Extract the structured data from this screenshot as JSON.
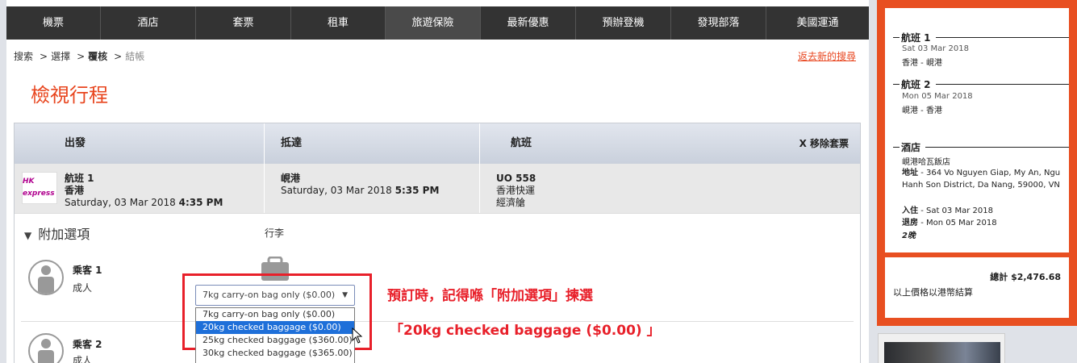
{
  "nav": [
    "機票",
    "酒店",
    "套票",
    "租車",
    "旅遊保險",
    "最新優惠",
    "預辦登機",
    "發現部落",
    "美國運通"
  ],
  "breadcrumb": {
    "step1": "搜索",
    "step2": "選擇",
    "step3": "覆核",
    "step4": "結帳"
  },
  "back_link": "返去新的搜尋",
  "page_title": "檢視行程",
  "table": {
    "headers": {
      "depart": "出發",
      "arrive": "抵達",
      "flight": "航班"
    },
    "remove": "X 移除套票",
    "row": {
      "airline_logo": "HK express",
      "flight_label": "航班 1",
      "origin": "香港",
      "depart_date": "Saturday, 03 Mar 2018",
      "depart_time": "4:35 PM",
      "dest": "峴港",
      "arrive_date": "Saturday, 03 Mar 2018",
      "arrive_time": "5:35 PM",
      "flight_no": "UO 558",
      "carrier": "香港快運",
      "cabin": "經濟艙"
    }
  },
  "addons": {
    "title": "附加選項",
    "luggage_label": "行李",
    "passengers": [
      {
        "name": "乘客 1",
        "type": "成人"
      },
      {
        "name": "乘客 2",
        "type": "成人"
      }
    ],
    "select_value": "7kg carry-on bag only ($0.00)",
    "options": [
      "7kg carry-on bag only ($0.00)",
      "20kg checked baggage ($0.00)",
      "25kg checked baggage ($360.00)",
      "30kg checked baggage ($365.00)"
    ],
    "selected_index": 1
  },
  "annotation": {
    "line1": "預訂時，記得喺「附加選項」揀選",
    "line2": "「20kg checked baggage ($0.00) 」"
  },
  "sidebar": {
    "flight1": {
      "title": "航班 1",
      "date": "Sat 03 Mar 2018",
      "route": "香港 - 峴港"
    },
    "flight2": {
      "title": "航班 2",
      "date": "Mon 05 Mar 2018",
      "route": "峴港 - 香港"
    },
    "hotel": {
      "title": "酒店",
      "name": "峴港哈瓦飯店",
      "address_label": "地址",
      "address": "- 364 Vo Nguyen Giap, My An, Ngu Hanh Son District, Da Nang, 59000, VN",
      "checkin_label": "入住",
      "checkin": "- Sat 03 Mar 2018",
      "checkout_label": "退房",
      "checkout": "- Mon 05 Mar 2018",
      "nights": "2晚"
    },
    "total_label": "總計",
    "total": "$2,476.68",
    "currency_note": "以上價格以港幣結算"
  }
}
